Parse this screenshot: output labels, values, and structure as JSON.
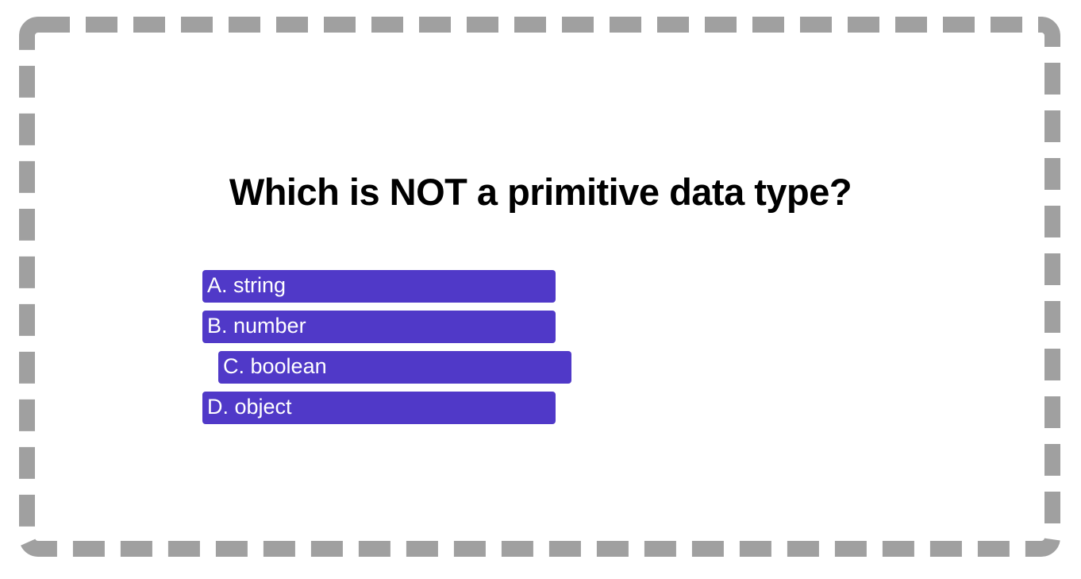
{
  "quiz": {
    "question": "Which is NOT a primitive data type?",
    "options": [
      {
        "label": "A. string"
      },
      {
        "label": "B. number"
      },
      {
        "label": "C. boolean"
      },
      {
        "label": "D. object"
      }
    ]
  },
  "colors": {
    "option_background": "#5039c8",
    "option_text": "#ffffff",
    "question_text": "#000000",
    "border_dash": "#a0a0a0",
    "page_background": "#ffffff"
  }
}
